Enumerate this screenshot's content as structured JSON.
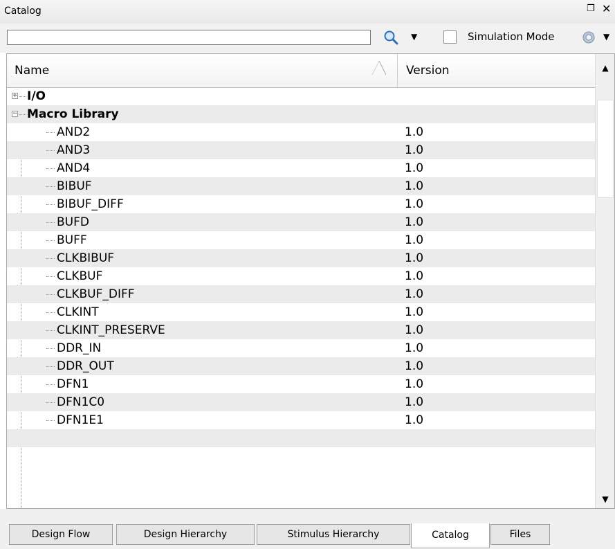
{
  "panel": {
    "title": "Catalog"
  },
  "toolbar": {
    "search_value": "",
    "simulation_mode_label": "Simulation Mode",
    "simulation_mode_checked": false
  },
  "table": {
    "headers": {
      "name": "Name",
      "version": "Version"
    },
    "groups": [
      {
        "label": "I/O",
        "expanded": false
      },
      {
        "label": "Macro Library",
        "expanded": true
      }
    ],
    "items": [
      {
        "name": "AND2",
        "version": "1.0"
      },
      {
        "name": "AND3",
        "version": "1.0"
      },
      {
        "name": "AND4",
        "version": "1.0"
      },
      {
        "name": "BIBUF",
        "version": "1.0"
      },
      {
        "name": "BIBUF_DIFF",
        "version": "1.0"
      },
      {
        "name": "BUFD",
        "version": "1.0"
      },
      {
        "name": "BUFF",
        "version": "1.0"
      },
      {
        "name": "CLKBIBUF",
        "version": "1.0"
      },
      {
        "name": "CLKBUF",
        "version": "1.0"
      },
      {
        "name": "CLKBUF_DIFF",
        "version": "1.0"
      },
      {
        "name": "CLKINT",
        "version": "1.0"
      },
      {
        "name": "CLKINT_PRESERVE",
        "version": "1.0"
      },
      {
        "name": "DDR_IN",
        "version": "1.0"
      },
      {
        "name": "DDR_OUT",
        "version": "1.0"
      },
      {
        "name": "DFN1",
        "version": "1.0"
      },
      {
        "name": "DFN1C0",
        "version": "1.0"
      },
      {
        "name": "DFN1E1",
        "version": "1.0"
      }
    ]
  },
  "tabs": [
    {
      "label": "Design Flow",
      "active": false
    },
    {
      "label": "Design Hierarchy",
      "active": false
    },
    {
      "label": "Stimulus Hierarchy",
      "active": false
    },
    {
      "label": "Catalog",
      "active": true
    },
    {
      "label": "Files",
      "active": false
    }
  ],
  "icons": {
    "search": "magnifier-icon",
    "gear": "gear-icon",
    "float": "float-window-icon",
    "close": "close-icon"
  },
  "colors": {
    "row_alt": "#ebebeb",
    "accent_icon": "#3a7bd5"
  }
}
